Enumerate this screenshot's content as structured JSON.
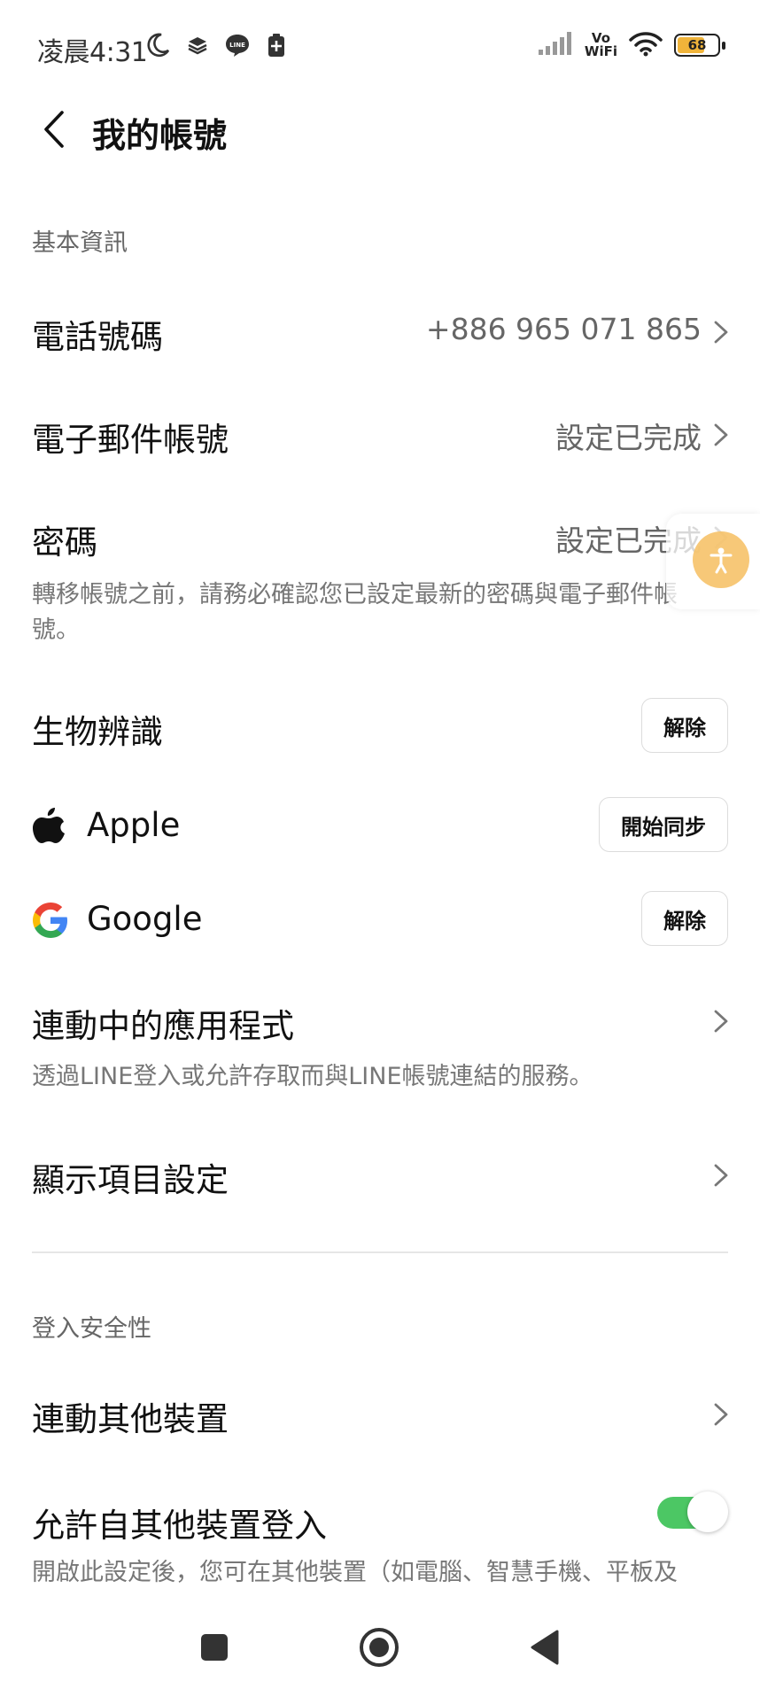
{
  "status_bar": {
    "time": "凌晨4:31",
    "vowifi_top": "Vo",
    "vowifi_bottom": "WiFi",
    "battery": "68",
    "icons": [
      "moon-icon",
      "layers-icon",
      "line-app-icon",
      "battery-saver-icon",
      "signal-icon",
      "wifi-icon",
      "battery-icon"
    ]
  },
  "header": {
    "title": "我的帳號",
    "back_icon": "chevron-left-icon"
  },
  "basic_info": {
    "section_title": "基本資訊",
    "phone": {
      "label": "電話號碼",
      "value": "+886 965 071 865"
    },
    "email": {
      "label": "電子郵件帳號",
      "value": "設定已完成"
    },
    "password": {
      "label": "密碼",
      "value": "設定已完成",
      "desc": "轉移帳號之前，請務必確認您已設定最新的密碼與電子郵件帳號。"
    },
    "biometric": {
      "label": "生物辨識",
      "button": "解除"
    },
    "apple": {
      "label": "Apple",
      "button": "開始同步"
    },
    "google": {
      "label": "Google",
      "button": "解除"
    },
    "linked_apps": {
      "label": "連動中的應用程式",
      "desc": "透過LINE登入或允許存取而與LINE帳號連結的服務。"
    },
    "display_settings": {
      "label": "顯示項目設定"
    }
  },
  "login_security": {
    "section_title": "登入安全性",
    "link_devices": {
      "label": "連動其他裝置"
    },
    "allow_login": {
      "label": "允許自其他裝置登入",
      "enabled": true,
      "desc": "開啟此設定後，您可在其他裝置（如電腦、智慧手機、平板及"
    }
  },
  "colors": {
    "accent_green": "#4cc764",
    "text_primary": "#111111",
    "text_secondary": "#666666",
    "accessibility_orange": "#f7c36a"
  },
  "nav_bar": {
    "icons": [
      "recents-square-icon",
      "home-circle-icon",
      "back-triangle-icon"
    ]
  }
}
